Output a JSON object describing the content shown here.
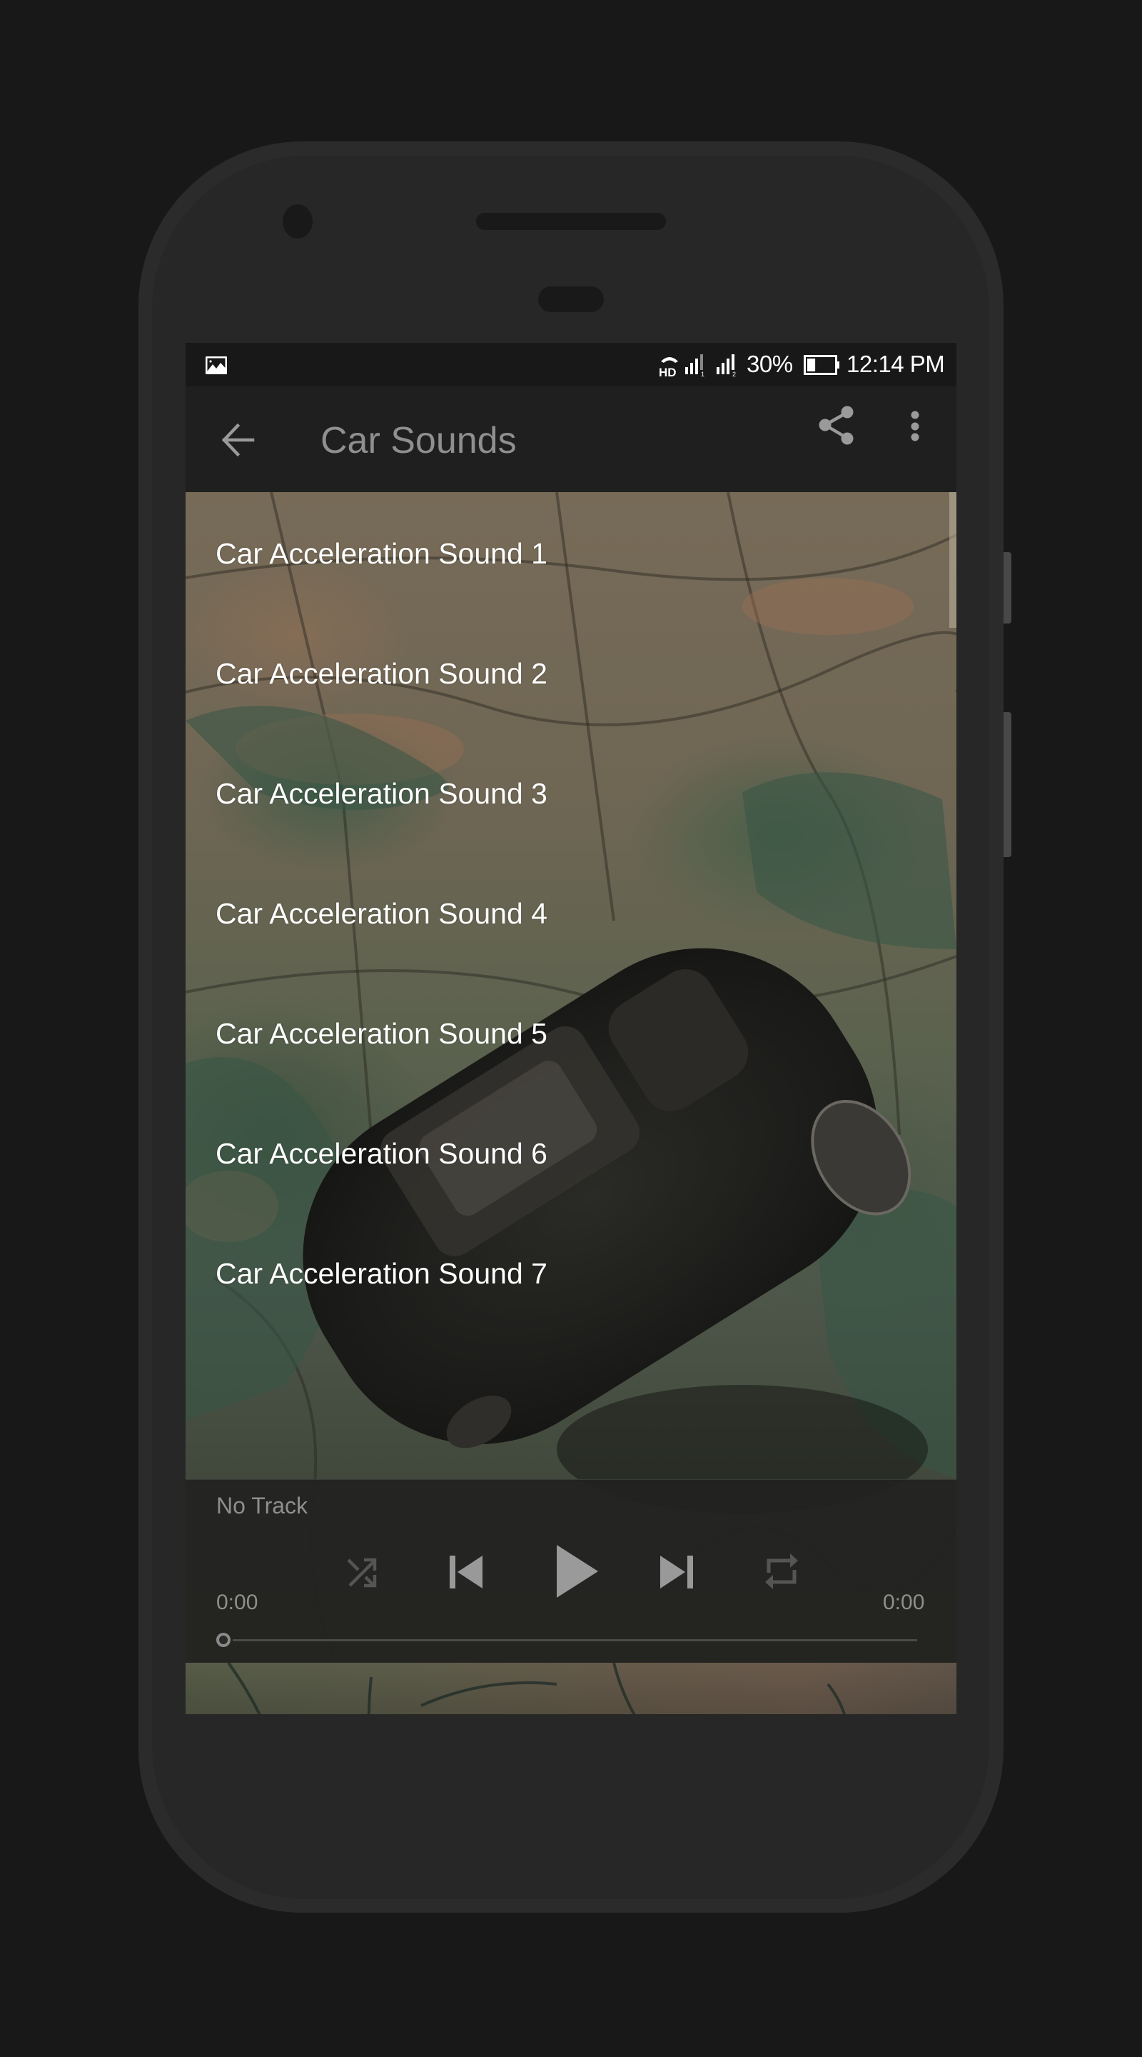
{
  "status_bar": {
    "notification_icon": "image-icon",
    "hd_call_label": "HD",
    "sim1_label": "1",
    "sim2_label": "2",
    "battery_percent_text": "30%",
    "battery_level": 0.3,
    "time": "12:14 PM"
  },
  "toolbar": {
    "back_icon": "arrow-back-icon",
    "title": "Car Sounds",
    "share_icon": "share-icon",
    "more_icon": "more-vert-icon"
  },
  "sound_list": {
    "items": [
      {
        "label": "Car Acceleration Sound 1"
      },
      {
        "label": "Car Acceleration Sound 2"
      },
      {
        "label": "Car Acceleration Sound 3"
      },
      {
        "label": "Car Acceleration Sound 4"
      },
      {
        "label": "Car Acceleration Sound 5"
      },
      {
        "label": "Car Acceleration Sound 6"
      },
      {
        "label": "Car Acceleration Sound 7"
      }
    ]
  },
  "player": {
    "track_name": "No Track",
    "elapsed": "0:00",
    "duration": "0:00",
    "progress": 0,
    "controls": {
      "shuffle_icon": "shuffle-icon",
      "previous_icon": "skip-previous-icon",
      "play_icon": "play-icon",
      "next_icon": "skip-next-icon",
      "repeat_icon": "repeat-icon"
    }
  },
  "colors": {
    "toolbar_bg": "#1f1f1f",
    "status_bar_bg": "#181818",
    "toolbar_icon": "#9a9a9a",
    "list_text": "#ffffff",
    "player_text": "#8e8e8e",
    "device_frame": "#2b2b2b",
    "page_bg": "#181818"
  }
}
